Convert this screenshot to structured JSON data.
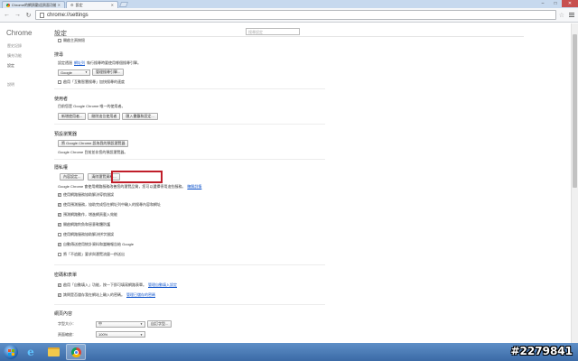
{
  "browser": {
    "tabs": [
      {
        "label": "Chrome的網頁歡迎頁面功能與工具"
      },
      {
        "label": "設定"
      }
    ],
    "url": "chrome://settings"
  },
  "sidebar": {
    "title": "Chrome",
    "items": [
      {
        "label": "歷史記錄"
      },
      {
        "label": "擴充功能"
      },
      {
        "label": "設定"
      },
      {
        "label": "說明"
      }
    ]
  },
  "settings": {
    "page_title": "設定",
    "search_placeholder": "搜尋設定",
    "top_item": "開啟主頁按鈕",
    "search": {
      "title": "搜尋",
      "desc_prefix": "設定透過",
      "desc_link": "網址列",
      "desc_suffix": "執行搜尋時要使用哪個搜尋引擎。",
      "engine": "Google",
      "manage_button": "管理搜尋引擎...",
      "instant_label": "啟用「互動智慧搜尋」加快搜尋的速度"
    },
    "users": {
      "title": "使用者",
      "desc": "目前您是 Google Chrome 唯一的使用者。",
      "add_button": "新增使用者...",
      "delete_button": "刪除這位使用者",
      "import_button": "匯入書籤和設定..."
    },
    "default_browser": {
      "title": "預設瀏覽器",
      "button": "將 Google Chrome 設為我的預設瀏覽器",
      "desc": "Google Chrome 目前並非您的預設瀏覽器。"
    },
    "privacy": {
      "title": "隱私權",
      "content_button": "內容設定...",
      "clear_button": "清除瀏覽資料...",
      "desc": "Google Chrome 會使用網路服務改善您的瀏覽品質，您可以選擇停用這些服務。",
      "desc_link": "瞭解詳情",
      "options": [
        {
          "label": "使用網路服務協助解決導航錯誤",
          "checked": true
        },
        {
          "label": "使用預測服務，協助完成您在網址列中輸入的搜尋內容和網址",
          "checked": true
        },
        {
          "label": "預測網路動作，增進網頁載入效能",
          "checked": true
        },
        {
          "label": "開啟網路釣魚和惡意軟體防護",
          "checked": true
        },
        {
          "label": "使用網路服務協助解決拼字錯誤",
          "checked": false
        },
        {
          "label": "自動傳送使用統計資料和當機報告給 Google",
          "checked": true
        },
        {
          "label": "將「不追蹤」要求與瀏覽流量一併送出",
          "checked": false
        }
      ]
    },
    "passwords": {
      "title": "密碼和表單",
      "autofill_prefix": "啟用「自動填入」功能，按一下即可填寫網路表單。",
      "autofill_link": "管理自動填入設定",
      "save_prefix": "詢問是否儲存我在網站上輸入的密碼。",
      "save_link": "管理已儲存的密碼"
    },
    "web_content": {
      "title": "網頁內容",
      "font_label": "字型大小：",
      "font_value": "中",
      "font_button": "自訂字型...",
      "zoom_label": "頁面縮放：",
      "zoom_value": "100%"
    }
  },
  "taskbar": {
    "watermark": "#2279841"
  }
}
